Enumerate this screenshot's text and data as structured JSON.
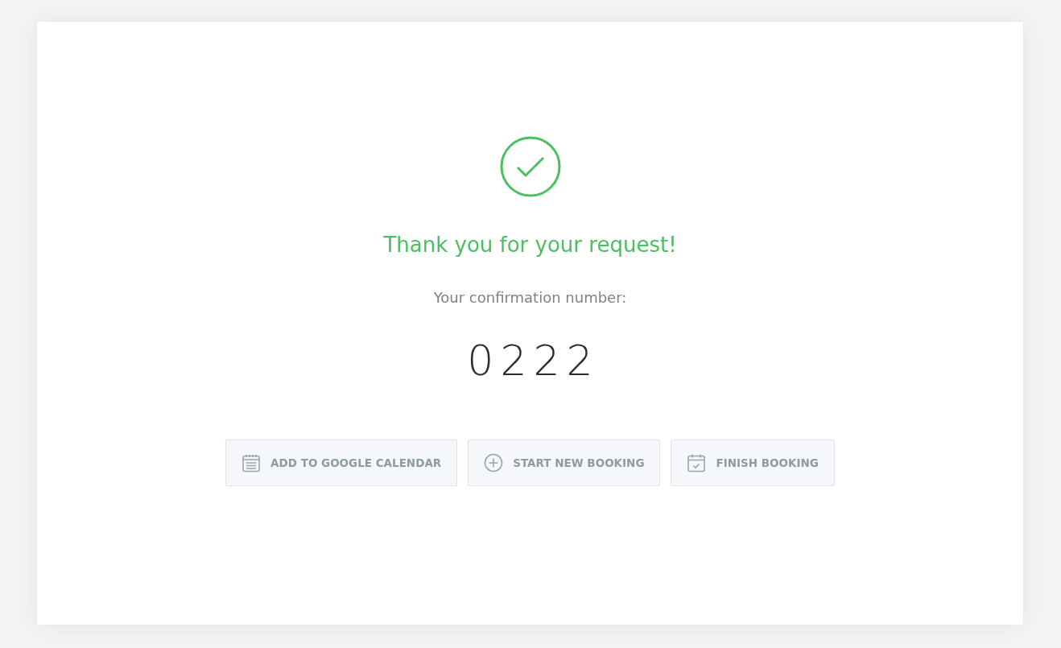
{
  "title": "Thank you for your request!",
  "subtitle": "Your confirmation number:",
  "confirmation_number": "0222",
  "buttons": [
    {
      "label": "ADD TO GOOGLE CALENDAR",
      "kind": "calendar"
    },
    {
      "label": "START NEW BOOKING",
      "kind": "plus"
    },
    {
      "label": "FINISH BOOKING",
      "kind": "calendar-check"
    }
  ]
}
